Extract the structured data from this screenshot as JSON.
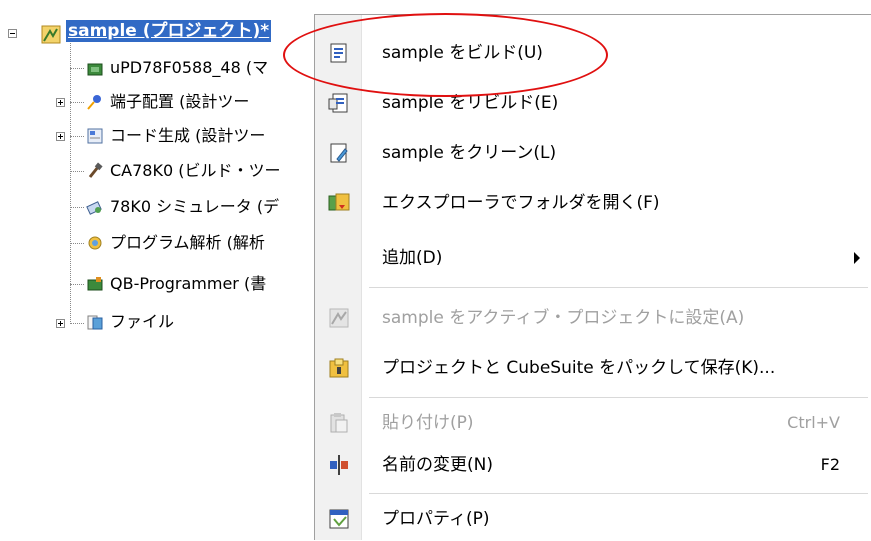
{
  "tree": {
    "root": {
      "label": "sample (プロジェクト)*",
      "icon": "project-icon"
    },
    "items": [
      {
        "label": "uPD78F0588_48 (マ",
        "icon": "microcontroller-icon",
        "expandable": false
      },
      {
        "label": "端子配置 (設計ツー",
        "icon": "pin-layout-icon",
        "expandable": true
      },
      {
        "label": "コード生成 (設計ツー",
        "icon": "code-generator-icon",
        "expandable": true
      },
      {
        "label": "CA78K0 (ビルド・ツー",
        "icon": "build-tool-icon",
        "expandable": false
      },
      {
        "label": "78K0 シミュレータ (デ",
        "icon": "simulator-icon",
        "expandable": false
      },
      {
        "label": "プログラム解析 (解析",
        "icon": "program-analyzer-icon",
        "expandable": false
      },
      {
        "label": "QB-Programmer (書",
        "icon": "programmer-icon",
        "expandable": false
      },
      {
        "label": "ファイル",
        "icon": "folder-icon",
        "expandable": true
      }
    ]
  },
  "menu": {
    "items": [
      {
        "label": "sample をビルド(U)",
        "icon": "build-icon",
        "disabled": false
      },
      {
        "label": "sample をリビルド(E)",
        "icon": "rebuild-icon",
        "disabled": false
      },
      {
        "label": "sample をクリーン(L)",
        "icon": "clean-icon",
        "disabled": false
      },
      {
        "label": "エクスプローラでフォルダを開く(F)",
        "icon": "explorer-icon",
        "disabled": false
      },
      {
        "label": "追加(D)",
        "icon": "",
        "disabled": false,
        "submenu": true
      },
      {
        "label": "sample をアクティブ・プロジェクトに設定(A)",
        "icon": "active-project-icon",
        "disabled": true
      },
      {
        "label": "プロジェクトと CubeSuite をパックして保存(K)...",
        "icon": "pack-save-icon",
        "disabled": false
      },
      {
        "label": "貼り付け(P)",
        "icon": "paste-icon",
        "disabled": true,
        "shortcut": "Ctrl+V"
      },
      {
        "label": "名前の変更(N)",
        "icon": "rename-icon",
        "disabled": false,
        "shortcut": "F2"
      },
      {
        "label": "プロパティ(P)",
        "icon": "properties-icon",
        "disabled": false
      }
    ]
  },
  "colors": {
    "selection": "#316ac5",
    "highlight_circle": "#e01010",
    "disabled_text": "#a0a0a0"
  }
}
